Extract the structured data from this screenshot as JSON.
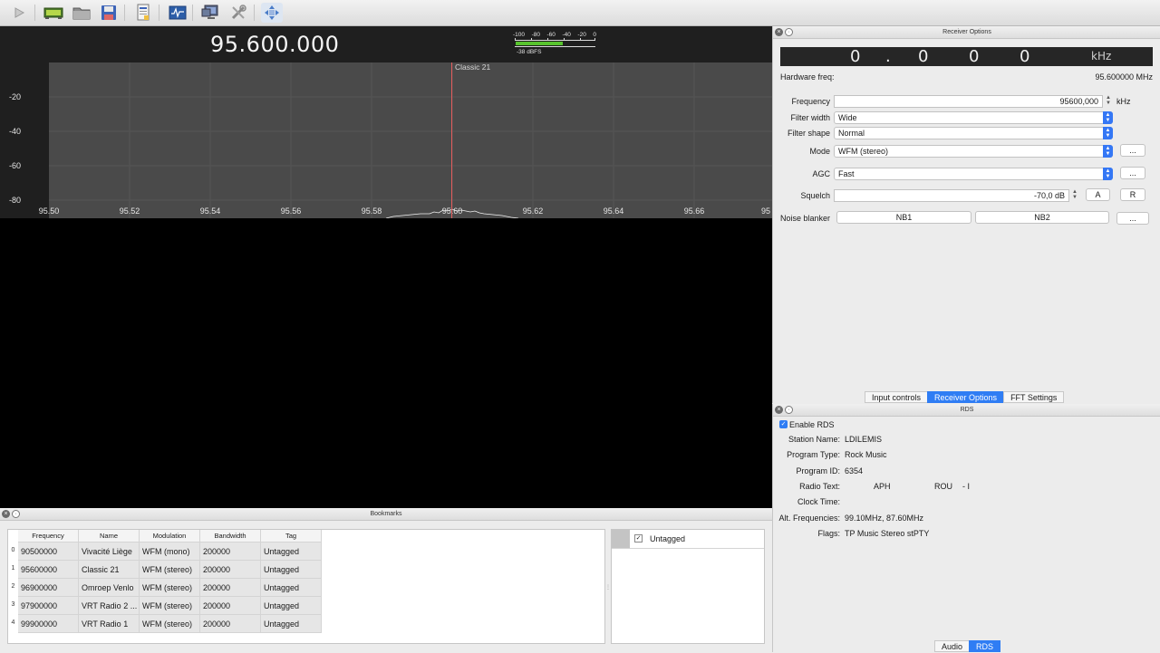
{
  "toolbar": {
    "buttons": [
      "play-icon",
      "receiver-icon",
      "folder-icon",
      "save-icon",
      "document-icon",
      "input-icon",
      "monitor-icon",
      "tools-icon",
      "fullscreen-icon"
    ]
  },
  "spectrum": {
    "frequency_display": "95.600.000",
    "meter": {
      "scale": [
        "-100",
        "-80",
        "-60",
        "-40",
        "-20",
        "0"
      ],
      "level_text": "-38 dBFS",
      "level_fraction": 0.6
    },
    "y_labels": [
      "-20",
      "-40",
      "-60",
      "-80"
    ],
    "x_labels": [
      "95.50",
      "95.52",
      "95.54",
      "95.56",
      "95.58",
      "95.60",
      "95.62",
      "95.64",
      "95.66",
      "95"
    ],
    "cursor_label": "Classic 21"
  },
  "receiver_options": {
    "title": "Receiver Options",
    "lcd": {
      "d1": "0",
      "dot": ".",
      "d2": "0",
      "d3": "0",
      "d4": "0",
      "unit": "kHz"
    },
    "hw_freq_label": "Hardware freq:",
    "hw_freq_value": "95.600000 MHz",
    "frequency_label": "Frequency",
    "frequency_value": "95600,000",
    "frequency_unit": "kHz",
    "filter_width_label": "Filter width",
    "filter_width_value": "Wide",
    "filter_shape_label": "Filter shape",
    "filter_shape_value": "Normal",
    "mode_label": "Mode",
    "mode_value": "WFM (stereo)",
    "agc_label": "AGC",
    "agc_value": "Fast",
    "more_label": "...",
    "squelch_label": "Squelch",
    "squelch_value": "-70,0 dB",
    "squelch_a": "A",
    "squelch_r": "R",
    "noise_blanker_label": "Noise blanker",
    "nb1": "NB1",
    "nb2": "NB2"
  },
  "dock_tabs_top": [
    "Input controls",
    "Receiver Options",
    "FFT Settings"
  ],
  "rds": {
    "title": "RDS",
    "enable_label": "Enable RDS",
    "station_name_label": "Station Name:",
    "station_name": "LDILEMIS",
    "program_type_label": "Program Type:",
    "program_type": "Rock Music",
    "program_id_label": "Program ID:",
    "program_id": "6354",
    "radio_text_label": "Radio Text:",
    "radio_text_a": "APH",
    "radio_text_b": "ROU",
    "radio_text_c": "- I",
    "clock_time_label": "Clock Time:",
    "clock_time": "",
    "alt_freq_label": "Alt. Frequencies:",
    "alt_freq": "99.10MHz, 87.60MHz",
    "flags_label": "Flags:",
    "flags": "TP Music Stereo stPTY"
  },
  "dock_tabs_bottom": [
    "Audio",
    "RDS"
  ],
  "bookmarks": {
    "title": "Bookmarks",
    "columns": [
      "Frequency",
      "Name",
      "Modulation",
      "Bandwidth",
      "Tag"
    ],
    "rows": [
      {
        "idx": "0",
        "frequency": "90500000",
        "name": "Vivacité Liège",
        "modulation": "WFM (mono)",
        "bandwidth": "200000",
        "tag": "Untagged"
      },
      {
        "idx": "1",
        "frequency": "95600000",
        "name": "Classic 21",
        "modulation": "WFM (stereo)",
        "bandwidth": "200000",
        "tag": "Untagged"
      },
      {
        "idx": "2",
        "frequency": "96900000",
        "name": "Omroep Venlo",
        "modulation": "WFM (stereo)",
        "bandwidth": "200000",
        "tag": "Untagged"
      },
      {
        "idx": "3",
        "frequency": "97900000",
        "name": "VRT Radio 2 ...",
        "modulation": "WFM (stereo)",
        "bandwidth": "200000",
        "tag": "Untagged"
      },
      {
        "idx": "4",
        "frequency": "99900000",
        "name": "VRT Radio 1",
        "modulation": "WFM (stereo)",
        "bandwidth": "200000",
        "tag": "Untagged"
      }
    ],
    "tag_item": "Untagged"
  },
  "colors": {
    "accent": "#2f7df4",
    "cursor": "#e35d5d",
    "meter": "#58c42e"
  }
}
